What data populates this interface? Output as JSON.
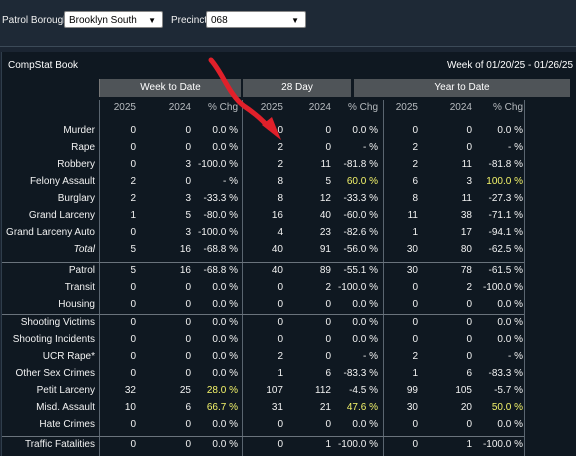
{
  "filters": {
    "borough_label": "Patrol Borough:",
    "borough_value": "Brooklyn South",
    "precinct_label": "Precinct:",
    "precinct_value": "068"
  },
  "panel": {
    "title": "CompStat Book",
    "week": "Week of 01/20/25 - 01/26/25"
  },
  "groups": [
    "Week to Date",
    "28 Day",
    "Year to Date"
  ],
  "col_headers": [
    "2025",
    "2024",
    "% Chg",
    "2025",
    "2024",
    "% Chg",
    "2025",
    "2024",
    "% Chg"
  ],
  "rows": [
    {
      "name": "Murder",
      "v": [
        "0",
        "0",
        "0.0 %",
        "0",
        "0",
        "0.0 %",
        "0",
        "0",
        "0.0 %"
      ]
    },
    {
      "name": "Rape",
      "v": [
        "0",
        "0",
        "0.0 %",
        "2",
        "0",
        "- %",
        "2",
        "0",
        "- %"
      ]
    },
    {
      "name": "Robbery",
      "v": [
        "0",
        "3",
        "-100.0 %",
        "2",
        "11",
        "-81.8 %",
        "2",
        "11",
        "-81.8 %"
      ]
    },
    {
      "name": "Felony Assault",
      "v": [
        "2",
        "0",
        "- %",
        "8",
        "5",
        "60.0 %",
        "6",
        "3",
        "100.0 %"
      ],
      "hl": [
        5,
        8
      ]
    },
    {
      "name": "Burglary",
      "v": [
        "2",
        "3",
        "-33.3 %",
        "8",
        "12",
        "-33.3 %",
        "8",
        "11",
        "-27.3 %"
      ]
    },
    {
      "name": "Grand Larceny",
      "v": [
        "1",
        "5",
        "-80.0 %",
        "16",
        "40",
        "-60.0 %",
        "11",
        "38",
        "-71.1 %"
      ]
    },
    {
      "name": "Grand Larceny Auto",
      "v": [
        "0",
        "3",
        "-100.0 %",
        "4",
        "23",
        "-82.6 %",
        "1",
        "17",
        "-94.1 %"
      ]
    },
    {
      "name": "Total",
      "v": [
        "5",
        "16",
        "-68.8 %",
        "40",
        "91",
        "-56.0 %",
        "30",
        "80",
        "-62.5 %"
      ],
      "total": true
    },
    {
      "name": "Patrol",
      "v": [
        "5",
        "16",
        "-68.8 %",
        "40",
        "89",
        "-55.1 %",
        "30",
        "78",
        "-61.5 %"
      ]
    },
    {
      "name": "Transit",
      "v": [
        "0",
        "0",
        "0.0 %",
        "0",
        "2",
        "-100.0 %",
        "0",
        "2",
        "-100.0 %"
      ]
    },
    {
      "name": "Housing",
      "v": [
        "0",
        "0",
        "0.0 %",
        "0",
        "0",
        "0.0 %",
        "0",
        "0",
        "0.0 %"
      ]
    },
    {
      "name": "Shooting Victims",
      "v": [
        "0",
        "0",
        "0.0 %",
        "0",
        "0",
        "0.0 %",
        "0",
        "0",
        "0.0 %"
      ]
    },
    {
      "name": "Shooting Incidents",
      "v": [
        "0",
        "0",
        "0.0 %",
        "0",
        "0",
        "0.0 %",
        "0",
        "0",
        "0.0 %"
      ]
    },
    {
      "name": "UCR Rape*",
      "v": [
        "0",
        "0",
        "0.0 %",
        "2",
        "0",
        "- %",
        "2",
        "0",
        "- %"
      ]
    },
    {
      "name": "Other Sex Crimes",
      "v": [
        "0",
        "0",
        "0.0 %",
        "1",
        "6",
        "-83.3 %",
        "1",
        "6",
        "-83.3 %"
      ]
    },
    {
      "name": "Petit Larceny",
      "v": [
        "32",
        "25",
        "28.0 %",
        "107",
        "112",
        "-4.5 %",
        "99",
        "105",
        "-5.7 %"
      ],
      "hl": [
        2
      ]
    },
    {
      "name": "Misd. Assault",
      "v": [
        "10",
        "6",
        "66.7 %",
        "31",
        "21",
        "47.6 %",
        "30",
        "20",
        "50.0 %"
      ],
      "hl": [
        2,
        5,
        8
      ]
    },
    {
      "name": "Hate Crimes",
      "v": [
        "0",
        "0",
        "0.0 %",
        "0",
        "0",
        "0.0 %",
        "0",
        "0",
        "0.0 %"
      ]
    },
    {
      "name": "Traffic Fatalities",
      "v": [
        "0",
        "0",
        "0.0 %",
        "0",
        "1",
        "-100.0 %",
        "0",
        "1",
        "-100.0 %"
      ]
    }
  ],
  "colors": {
    "highlight": "#f3f36a",
    "arrow": "#e0202a"
  }
}
